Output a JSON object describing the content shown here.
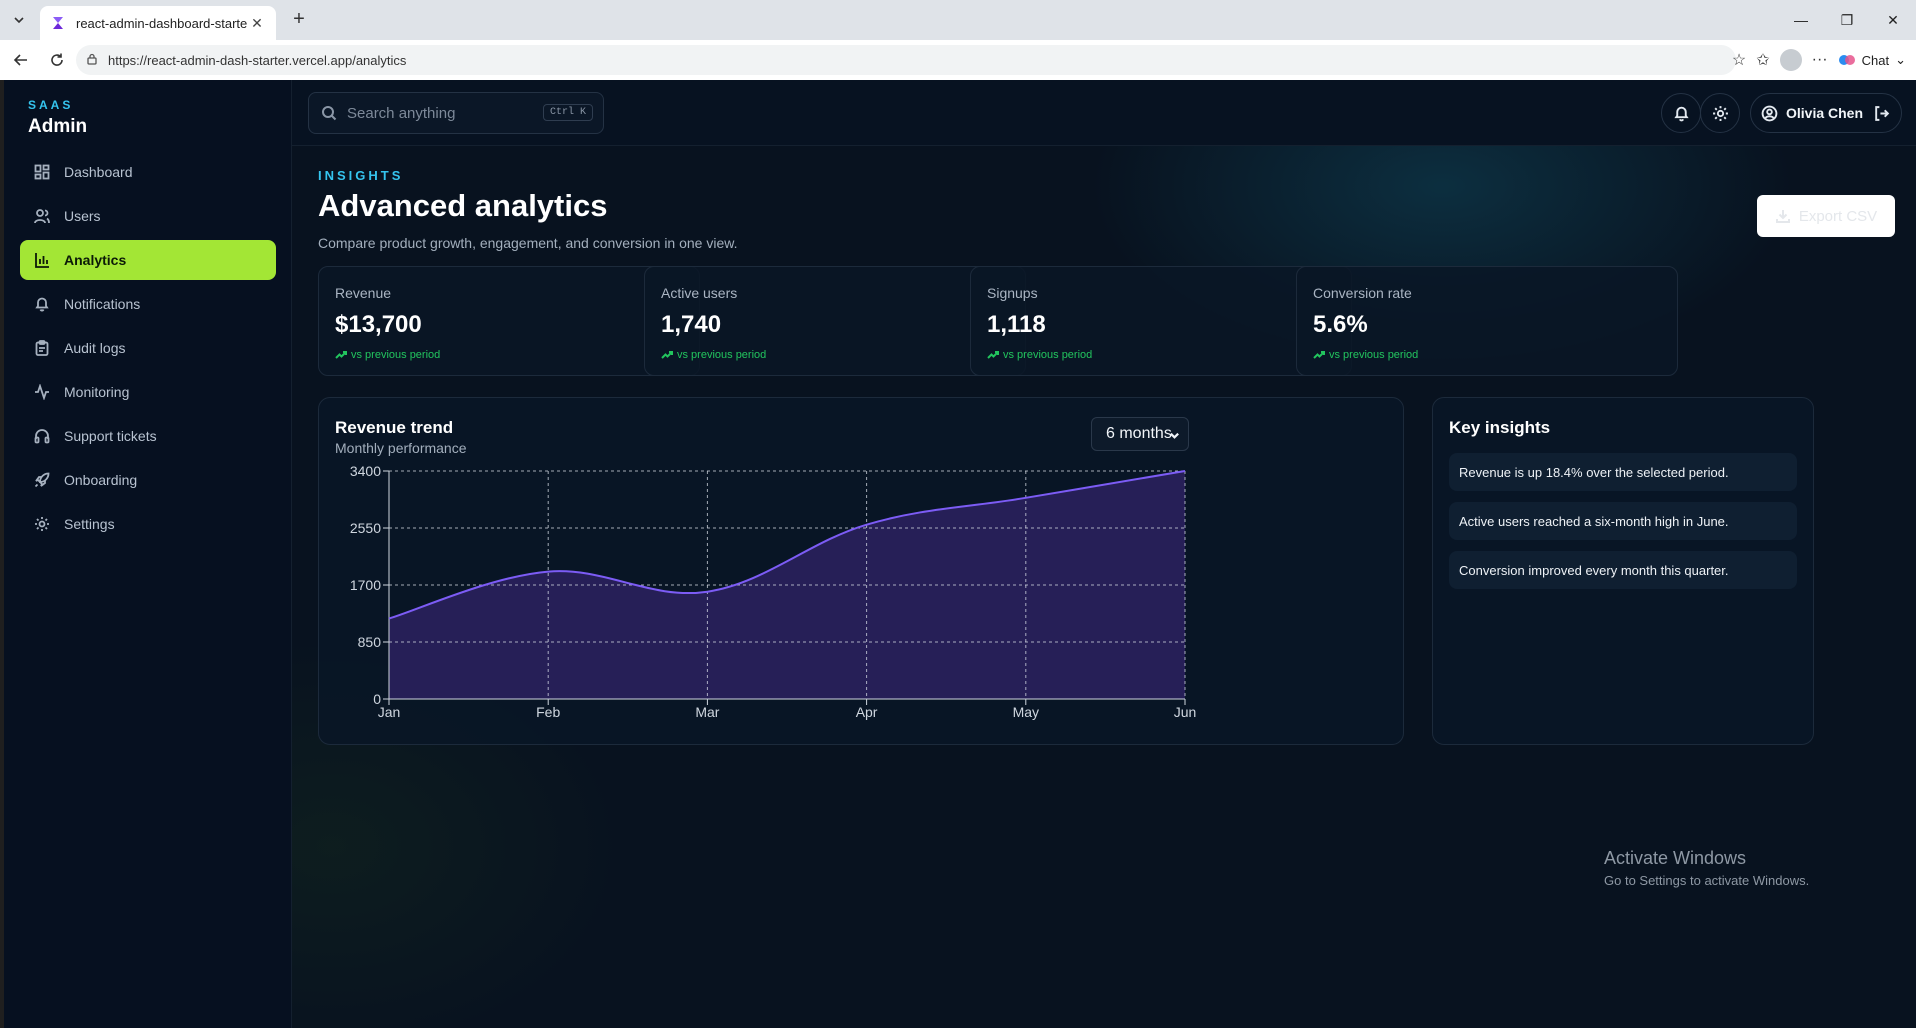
{
  "browser": {
    "tab_title": "react-admin-dashboard-starter-te",
    "url": "https://react-admin-dash-starter.vercel.app/analytics",
    "chat_label": "Chat"
  },
  "brand": {
    "kicker": "SAAS",
    "title": "Admin"
  },
  "sidebar": {
    "items": [
      {
        "label": "Dashboard",
        "icon": "dashboard-icon"
      },
      {
        "label": "Users",
        "icon": "users-icon"
      },
      {
        "label": "Analytics",
        "icon": "bar-chart-icon",
        "active": true
      },
      {
        "label": "Notifications",
        "icon": "bell-icon"
      },
      {
        "label": "Audit logs",
        "icon": "clipboard-icon"
      },
      {
        "label": "Monitoring",
        "icon": "activity-icon"
      },
      {
        "label": "Support tickets",
        "icon": "headphones-icon"
      },
      {
        "label": "Onboarding",
        "icon": "rocket-icon"
      },
      {
        "label": "Settings",
        "icon": "gear-icon"
      }
    ]
  },
  "topbar": {
    "search_placeholder": "Search anything",
    "search_shortcut": "Ctrl K",
    "user_name": "Olivia Chen"
  },
  "page": {
    "kicker": "INSIGHTS",
    "title": "Advanced analytics",
    "subtitle": "Compare product growth, engagement, and conversion in one view.",
    "export_label": "Export CSV"
  },
  "stats": [
    {
      "label": "Revenue",
      "value": "$13,700",
      "delta": "vs previous period"
    },
    {
      "label": "Active users",
      "value": "1,740",
      "delta": "vs previous period"
    },
    {
      "label": "Signups",
      "value": "1,118",
      "delta": "vs previous period"
    },
    {
      "label": "Conversion rate",
      "value": "5.6%",
      "delta": "vs previous period"
    }
  ],
  "revenue_card": {
    "title": "Revenue trend",
    "subtitle": "Monthly performance",
    "range_value": "6 months"
  },
  "chart_data": {
    "type": "area",
    "title": "Revenue trend",
    "categories": [
      "Jan",
      "Feb",
      "Mar",
      "Apr",
      "May",
      "Jun"
    ],
    "series": [
      {
        "values": [
          1200,
          1900,
          1600,
          2600,
          3000,
          3400
        ]
      }
    ],
    "yticks": [
      0,
      850,
      1700,
      2550,
      3400
    ],
    "ylim": [
      0,
      3400
    ],
    "grid": true,
    "colors": {
      "line": "#7c5cf5",
      "fill": "#2b2160"
    }
  },
  "insights": {
    "title": "Key insights",
    "items": [
      "Revenue is up 18.4% over the selected period.",
      "Active users reached a six-month high in June.",
      "Conversion improved every month this quarter."
    ]
  },
  "watermark": {
    "line1": "Activate Windows",
    "line2": "Go to Settings to activate Windows."
  }
}
